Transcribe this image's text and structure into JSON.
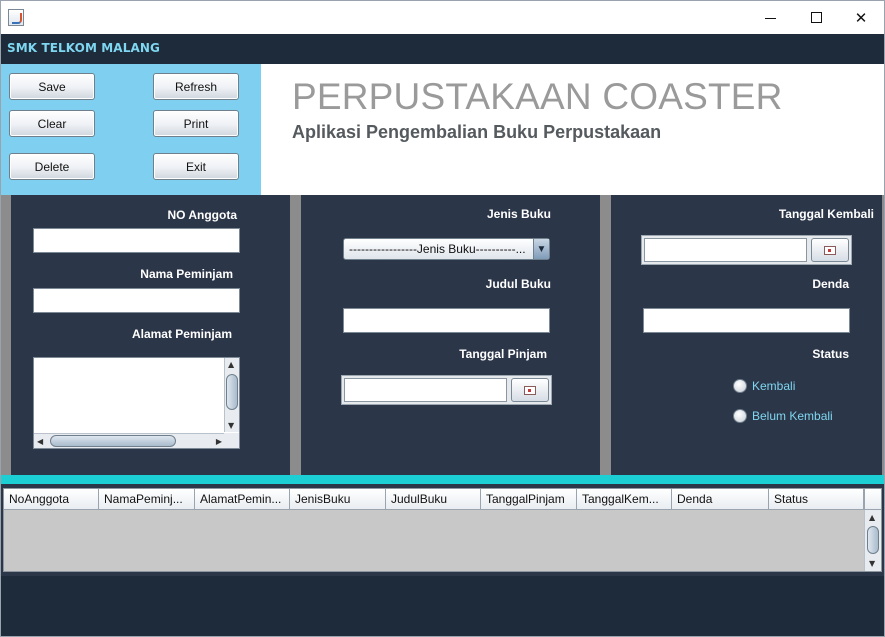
{
  "window": {
    "minimize_glyph": "minimize",
    "maximize_glyph": "maximize",
    "close_glyph": "✕"
  },
  "topbar": {
    "label": "SMK TELKOM MALANG"
  },
  "buttons": {
    "save": "Save",
    "refresh": "Refresh",
    "clear": "Clear",
    "print": "Print",
    "delete": "Delete",
    "exit": "Exit"
  },
  "header": {
    "title": "PERPUSTAKAAN COASTER",
    "subtitle": "Aplikasi Pengembalian Buku Perpustakaan"
  },
  "form": {
    "no_anggota_label": "NO Anggota",
    "no_anggota_value": "",
    "nama_peminjam_label": "Nama Peminjam",
    "nama_peminjam_value": "",
    "alamat_peminjam_label": "Alamat Peminjam",
    "alamat_peminjam_value": "",
    "jenis_buku_label": "Jenis Buku",
    "jenis_buku_selected": "-----------------Jenis Buku----------...",
    "judul_buku_label": "Judul Buku",
    "judul_buku_value": "",
    "tanggal_pinjam_label": "Tanggal Pinjam",
    "tanggal_pinjam_value": "",
    "tanggal_kembali_label": "Tanggal Kembali",
    "tanggal_kembali_value": "",
    "denda_label": "Denda",
    "denda_value": "",
    "status_label": "Status",
    "status_options": [
      "Kembali",
      "Belum Kembali"
    ]
  },
  "table": {
    "columns": [
      "NoAnggota",
      "NamaPeminj...",
      "AlamatPemin...",
      "JenisBuku",
      "JudulBuku",
      "TanggalPinjam",
      "TanggalKem...",
      "Denda",
      "Status"
    ],
    "rows": []
  },
  "colors": {
    "dark_navy": "#1e2b3a",
    "panel": "#2c3649",
    "light_blue": "#7fd0f0",
    "cyan_accent": "#1bcfd5",
    "label_cyan": "#7ed6f0"
  }
}
